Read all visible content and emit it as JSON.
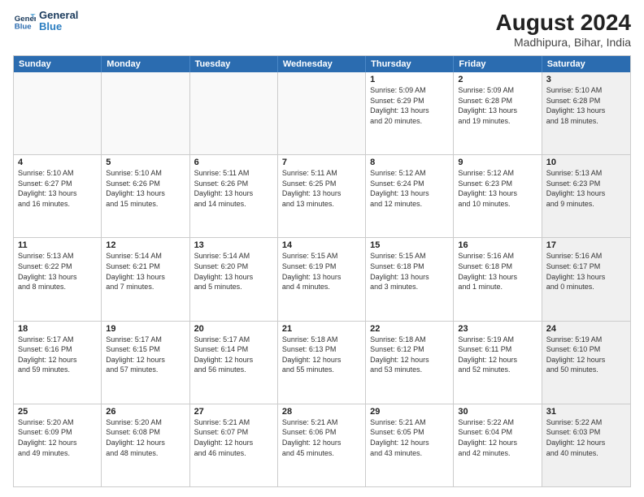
{
  "header": {
    "logo_line1": "General",
    "logo_line2": "Blue",
    "month_year": "August 2024",
    "location": "Madhipura, Bihar, India"
  },
  "day_headers": [
    "Sunday",
    "Monday",
    "Tuesday",
    "Wednesday",
    "Thursday",
    "Friday",
    "Saturday"
  ],
  "weeks": [
    [
      {
        "num": "",
        "info": "",
        "empty": true
      },
      {
        "num": "",
        "info": "",
        "empty": true
      },
      {
        "num": "",
        "info": "",
        "empty": true
      },
      {
        "num": "",
        "info": "",
        "empty": true
      },
      {
        "num": "1",
        "info": "Sunrise: 5:09 AM\nSunset: 6:29 PM\nDaylight: 13 hours\nand 20 minutes."
      },
      {
        "num": "2",
        "info": "Sunrise: 5:09 AM\nSunset: 6:28 PM\nDaylight: 13 hours\nand 19 minutes."
      },
      {
        "num": "3",
        "info": "Sunrise: 5:10 AM\nSunset: 6:28 PM\nDaylight: 13 hours\nand 18 minutes.",
        "shaded": true
      }
    ],
    [
      {
        "num": "4",
        "info": "Sunrise: 5:10 AM\nSunset: 6:27 PM\nDaylight: 13 hours\nand 16 minutes."
      },
      {
        "num": "5",
        "info": "Sunrise: 5:10 AM\nSunset: 6:26 PM\nDaylight: 13 hours\nand 15 minutes."
      },
      {
        "num": "6",
        "info": "Sunrise: 5:11 AM\nSunset: 6:26 PM\nDaylight: 13 hours\nand 14 minutes."
      },
      {
        "num": "7",
        "info": "Sunrise: 5:11 AM\nSunset: 6:25 PM\nDaylight: 13 hours\nand 13 minutes."
      },
      {
        "num": "8",
        "info": "Sunrise: 5:12 AM\nSunset: 6:24 PM\nDaylight: 13 hours\nand 12 minutes."
      },
      {
        "num": "9",
        "info": "Sunrise: 5:12 AM\nSunset: 6:23 PM\nDaylight: 13 hours\nand 10 minutes."
      },
      {
        "num": "10",
        "info": "Sunrise: 5:13 AM\nSunset: 6:23 PM\nDaylight: 13 hours\nand 9 minutes.",
        "shaded": true
      }
    ],
    [
      {
        "num": "11",
        "info": "Sunrise: 5:13 AM\nSunset: 6:22 PM\nDaylight: 13 hours\nand 8 minutes."
      },
      {
        "num": "12",
        "info": "Sunrise: 5:14 AM\nSunset: 6:21 PM\nDaylight: 13 hours\nand 7 minutes."
      },
      {
        "num": "13",
        "info": "Sunrise: 5:14 AM\nSunset: 6:20 PM\nDaylight: 13 hours\nand 5 minutes."
      },
      {
        "num": "14",
        "info": "Sunrise: 5:15 AM\nSunset: 6:19 PM\nDaylight: 13 hours\nand 4 minutes."
      },
      {
        "num": "15",
        "info": "Sunrise: 5:15 AM\nSunset: 6:18 PM\nDaylight: 13 hours\nand 3 minutes."
      },
      {
        "num": "16",
        "info": "Sunrise: 5:16 AM\nSunset: 6:18 PM\nDaylight: 13 hours\nand 1 minute."
      },
      {
        "num": "17",
        "info": "Sunrise: 5:16 AM\nSunset: 6:17 PM\nDaylight: 13 hours\nand 0 minutes.",
        "shaded": true
      }
    ],
    [
      {
        "num": "18",
        "info": "Sunrise: 5:17 AM\nSunset: 6:16 PM\nDaylight: 12 hours\nand 59 minutes."
      },
      {
        "num": "19",
        "info": "Sunrise: 5:17 AM\nSunset: 6:15 PM\nDaylight: 12 hours\nand 57 minutes."
      },
      {
        "num": "20",
        "info": "Sunrise: 5:17 AM\nSunset: 6:14 PM\nDaylight: 12 hours\nand 56 minutes."
      },
      {
        "num": "21",
        "info": "Sunrise: 5:18 AM\nSunset: 6:13 PM\nDaylight: 12 hours\nand 55 minutes."
      },
      {
        "num": "22",
        "info": "Sunrise: 5:18 AM\nSunset: 6:12 PM\nDaylight: 12 hours\nand 53 minutes."
      },
      {
        "num": "23",
        "info": "Sunrise: 5:19 AM\nSunset: 6:11 PM\nDaylight: 12 hours\nand 52 minutes."
      },
      {
        "num": "24",
        "info": "Sunrise: 5:19 AM\nSunset: 6:10 PM\nDaylight: 12 hours\nand 50 minutes.",
        "shaded": true
      }
    ],
    [
      {
        "num": "25",
        "info": "Sunrise: 5:20 AM\nSunset: 6:09 PM\nDaylight: 12 hours\nand 49 minutes."
      },
      {
        "num": "26",
        "info": "Sunrise: 5:20 AM\nSunset: 6:08 PM\nDaylight: 12 hours\nand 48 minutes."
      },
      {
        "num": "27",
        "info": "Sunrise: 5:21 AM\nSunset: 6:07 PM\nDaylight: 12 hours\nand 46 minutes."
      },
      {
        "num": "28",
        "info": "Sunrise: 5:21 AM\nSunset: 6:06 PM\nDaylight: 12 hours\nand 45 minutes."
      },
      {
        "num": "29",
        "info": "Sunrise: 5:21 AM\nSunset: 6:05 PM\nDaylight: 12 hours\nand 43 minutes."
      },
      {
        "num": "30",
        "info": "Sunrise: 5:22 AM\nSunset: 6:04 PM\nDaylight: 12 hours\nand 42 minutes."
      },
      {
        "num": "31",
        "info": "Sunrise: 5:22 AM\nSunset: 6:03 PM\nDaylight: 12 hours\nand 40 minutes.",
        "shaded": true
      }
    ]
  ]
}
